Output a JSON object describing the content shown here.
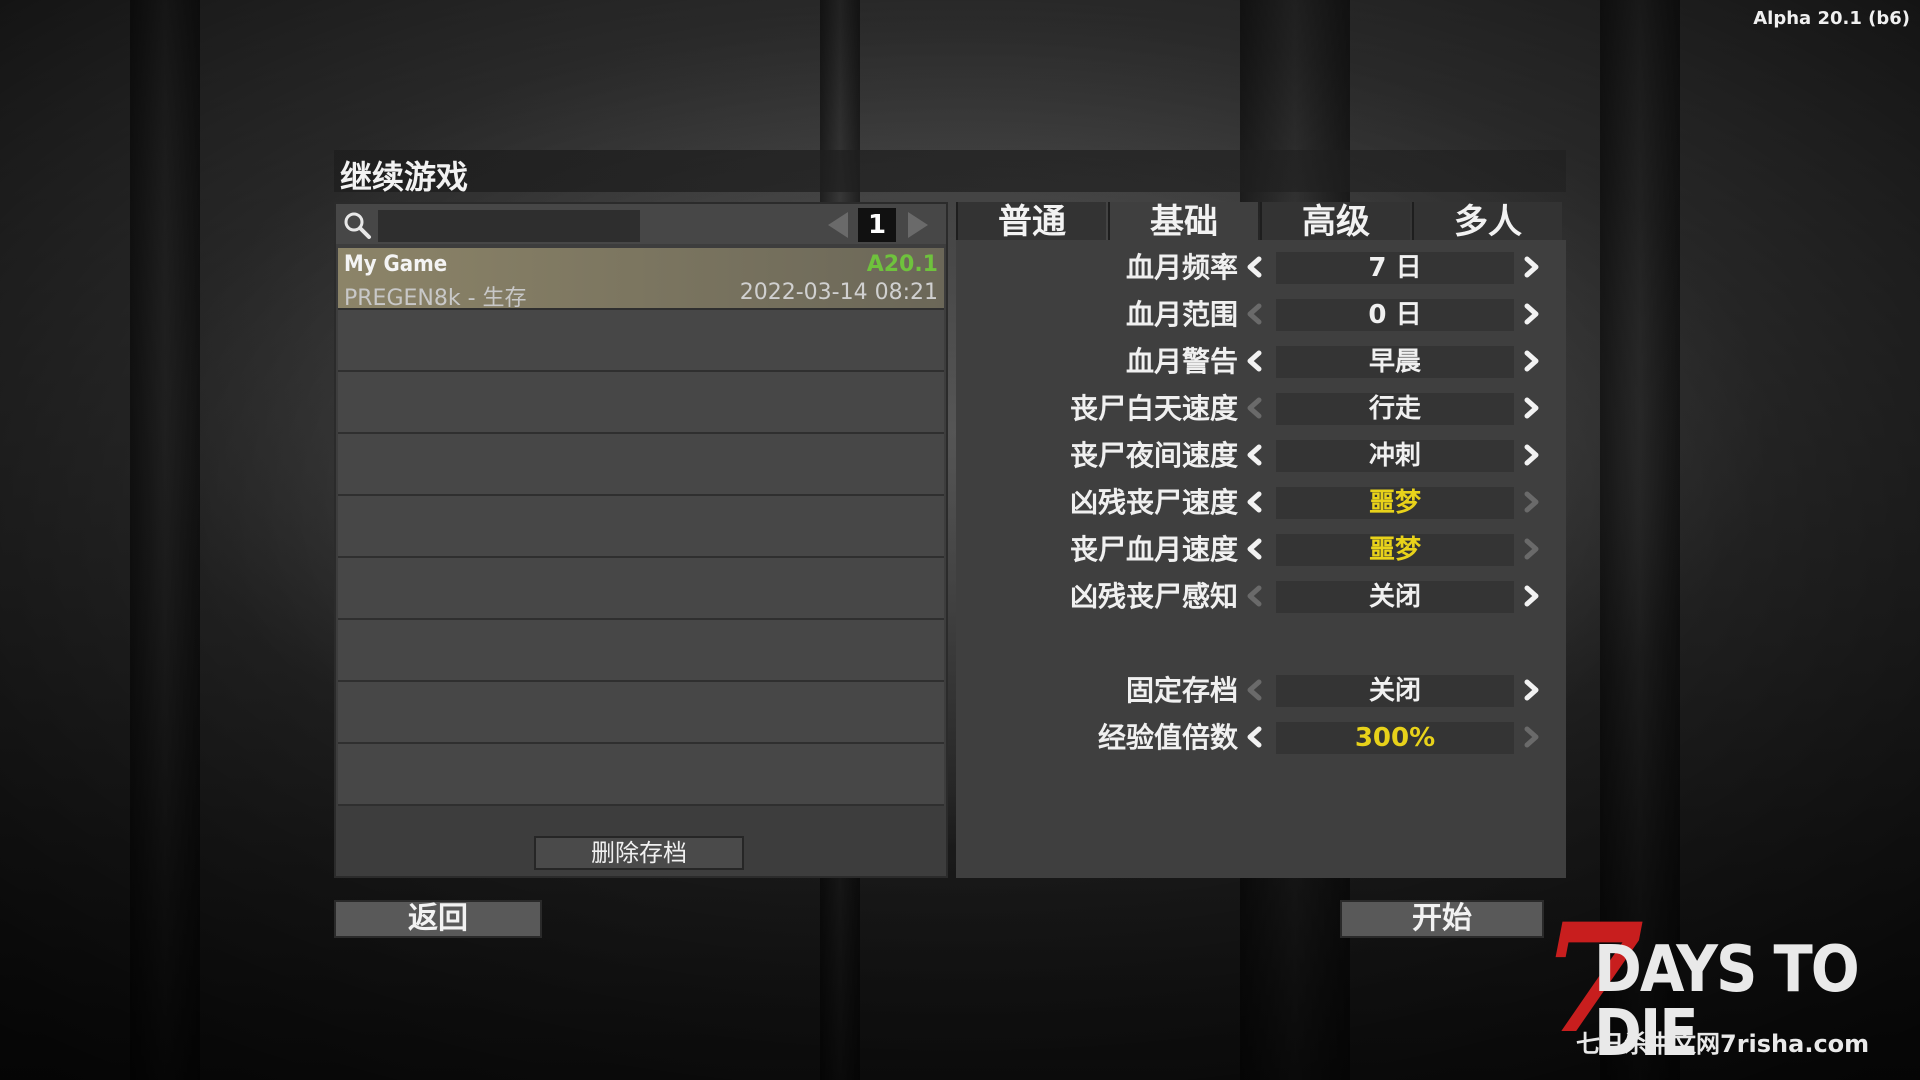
{
  "version": "Alpha 20.1 (b6)",
  "title": "继续游戏",
  "saves": {
    "search_placeholder": "",
    "page": "1",
    "rows": [
      {
        "name": "My Game",
        "version": "A20.1",
        "world": "PREGEN8k - 生存",
        "date": "2022-03-14 08:21"
      }
    ],
    "delete_label": "删除存档"
  },
  "tabs": [
    "普通",
    "基础",
    "高级",
    "多人"
  ],
  "active_tab": "基础",
  "settings": [
    {
      "label": "血月频率",
      "value": "7 日",
      "left_enabled": true,
      "right_enabled": true,
      "highlight": false
    },
    {
      "label": "血月范围",
      "value": "0 日",
      "left_enabled": false,
      "right_enabled": true,
      "highlight": false
    },
    {
      "label": "血月警告",
      "value": "早晨",
      "left_enabled": true,
      "right_enabled": true,
      "highlight": false
    },
    {
      "label": "丧尸白天速度",
      "value": "行走",
      "left_enabled": false,
      "right_enabled": true,
      "highlight": false
    },
    {
      "label": "丧尸夜间速度",
      "value": "冲刺",
      "left_enabled": true,
      "right_enabled": true,
      "highlight": false
    },
    {
      "label": "凶残丧尸速度",
      "value": "噩梦",
      "left_enabled": true,
      "right_enabled": false,
      "highlight": true
    },
    {
      "label": "丧尸血月速度",
      "value": "噩梦",
      "left_enabled": true,
      "right_enabled": false,
      "highlight": true
    },
    {
      "label": "凶残丧尸感知",
      "value": "关闭",
      "left_enabled": false,
      "right_enabled": true,
      "highlight": false
    },
    {
      "label": "固定存档",
      "value": "关闭",
      "left_enabled": false,
      "right_enabled": true,
      "highlight": false
    },
    {
      "label": "经验值倍数",
      "value": "300%",
      "left_enabled": true,
      "right_enabled": false,
      "highlight": true
    }
  ],
  "buttons": {
    "back": "返回",
    "start": "开始"
  },
  "logo": {
    "seven": "7",
    "main": "DAYS TO DIE",
    "sub": "七日杀中文网7risha.com"
  },
  "colors": {
    "accent_green": "#6fc23d",
    "highlight_yellow": "#e8d21a",
    "logo_red": "#c81e1e"
  }
}
